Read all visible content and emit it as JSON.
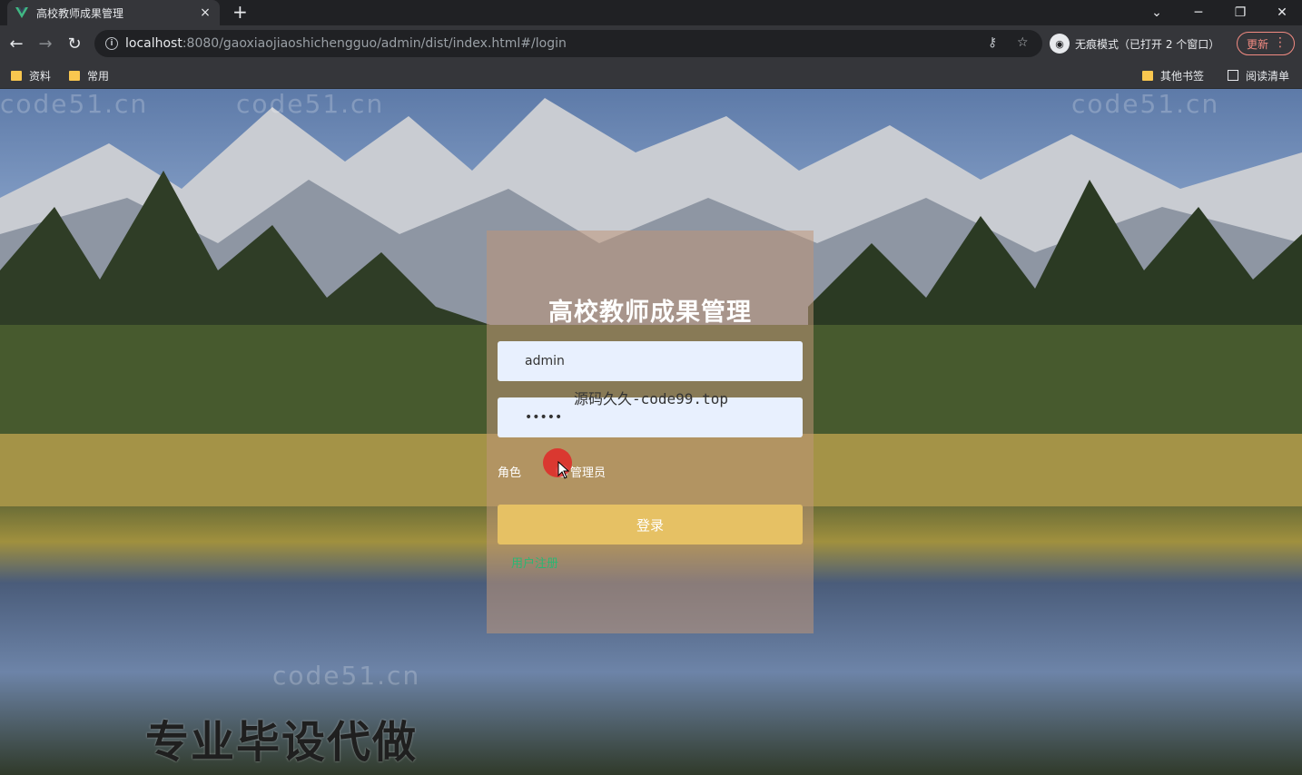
{
  "browser": {
    "tab_title": "高校教师成果管理",
    "tab_close": "×",
    "new_tab": "+",
    "url_host": "localhost",
    "url_rest": ":8080/gaoxiaojiaoshichengguo/admin/dist/index.html#/login",
    "incognito_label": "无痕模式（已打开 2 个窗口）",
    "update_label": "更新"
  },
  "bookmarks": {
    "left": [
      {
        "label": "资料"
      },
      {
        "label": "常用"
      }
    ],
    "other": "其他书签",
    "reading_list": "阅读清单"
  },
  "login": {
    "title": "高校教师成果管理",
    "username_value": "admin",
    "password_value": "•••••",
    "role_label": "角色",
    "role_option": "管理员",
    "submit_label": "登录",
    "register_link": "用户注册"
  },
  "overlays": {
    "center_watermark": "源码久久-code99.top",
    "bottom_banner": "专业毕设代做",
    "tiled_watermark": "code51.cn"
  },
  "colors": {
    "button_accent": "#e6c164",
    "register_link": "#2bb673",
    "panel_bg": "rgba(190,150,120,0.55)"
  }
}
